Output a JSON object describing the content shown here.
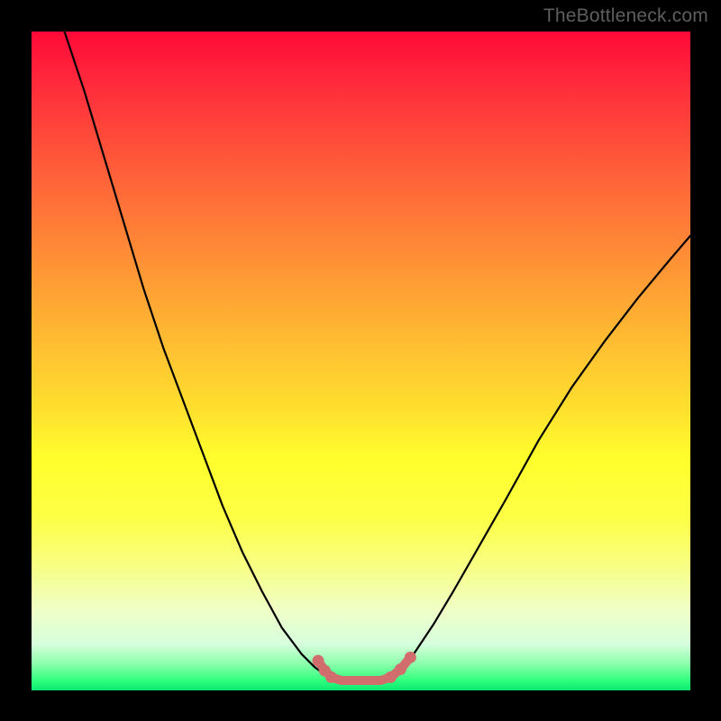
{
  "watermark": {
    "text": "TheBottleneck.com"
  },
  "chart_data": {
    "type": "line",
    "title": "",
    "xlabel": "",
    "ylabel": "",
    "xlim": [
      0,
      1
    ],
    "ylim": [
      0,
      1
    ],
    "note": "Values are normalized 0–1; x across plot width, y is curve height (0 at top, 1 at bottom).",
    "series": [
      {
        "name": "curve",
        "stroke": "#000000",
        "x": [
          0.05,
          0.08,
          0.11,
          0.14,
          0.17,
          0.2,
          0.23,
          0.26,
          0.29,
          0.32,
          0.35,
          0.38,
          0.41,
          0.43,
          0.448,
          0.47,
          0.5,
          0.53,
          0.55,
          0.565,
          0.58,
          0.61,
          0.64,
          0.68,
          0.72,
          0.77,
          0.82,
          0.87,
          0.92,
          0.97,
          1.0
        ],
        "y": [
          0.0,
          0.09,
          0.19,
          0.29,
          0.39,
          0.48,
          0.56,
          0.64,
          0.72,
          0.79,
          0.85,
          0.905,
          0.945,
          0.965,
          0.978,
          0.985,
          0.985,
          0.985,
          0.978,
          0.965,
          0.945,
          0.9,
          0.85,
          0.78,
          0.71,
          0.62,
          0.54,
          0.47,
          0.405,
          0.345,
          0.31
        ]
      },
      {
        "name": "marker-segment",
        "stroke": "#d26d6d",
        "x": [
          0.435,
          0.445,
          0.455,
          0.47,
          0.5,
          0.53,
          0.545,
          0.56,
          0.575
        ],
        "y": [
          0.955,
          0.97,
          0.98,
          0.985,
          0.985,
          0.985,
          0.98,
          0.968,
          0.95
        ]
      }
    ],
    "markers": {
      "name": "dots",
      "fill": "#d26d6d",
      "x": [
        0.435,
        0.445,
        0.455,
        0.545,
        0.56,
        0.575
      ],
      "y": [
        0.955,
        0.97,
        0.98,
        0.98,
        0.968,
        0.95
      ]
    }
  }
}
